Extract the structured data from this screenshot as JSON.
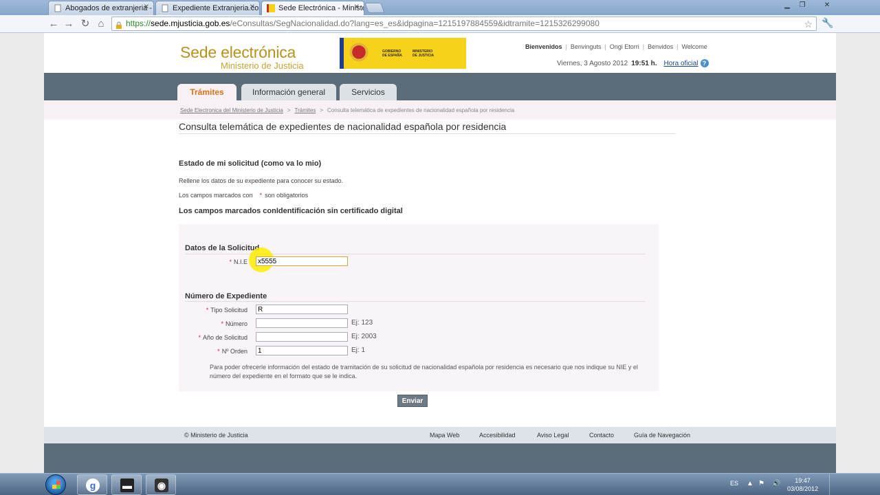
{
  "browser": {
    "tabs": [
      {
        "title": "Abogados de extranjeria - J",
        "active": false
      },
      {
        "title": "Expediente Extranjeria.com",
        "active": false
      },
      {
        "title": "Sede Electrónica - Minister",
        "active": true
      }
    ],
    "url": {
      "scheme": "https://",
      "host": "sede.mjusticia.gob.es",
      "path": "/eConsultas/SegNacionalidad.do?lang=es_es&idpagina=1215197884559&idtramite=1215326299080"
    }
  },
  "header": {
    "title": "Sede electrónica",
    "subtitle": "Ministerio de Justicia",
    "logo_text_1": "GOBIERNO\nDE ESPAÑA",
    "logo_text_2": "MINISTERIO\nDE JUSTICIA",
    "languages": [
      "Bienvenidos",
      "Benvinguts",
      "Ongi Etorri",
      "Benvidos",
      "Welcome"
    ],
    "date": "Viernes, 3 Agosto 2012",
    "time": "19:51 h.",
    "official_time_link": "Hora oficial"
  },
  "nav": {
    "tabs": [
      {
        "label": "Trámites",
        "active": true
      },
      {
        "label": "Información general",
        "active": false
      },
      {
        "label": "Servicios",
        "active": false
      }
    ]
  },
  "breadcrumb": {
    "items": [
      "Sede Electronica del Ministerio de Justicia",
      "Trámites",
      "Consulta telemática de expedientes de nacionalidad española por residencia"
    ],
    "separator": ">"
  },
  "page": {
    "title": "Consulta telemática de expedientes de nacionalidad española por residencia",
    "section_heading": "Estado de mi solicitud (como va lo mio)",
    "intro": "Rellene los datos de su expediente para conocer su estado.",
    "required_prefix": "Los campos marcados con",
    "required_asterisk": "*",
    "required_suffix": "son obligatorios",
    "cert_heading": "Los campos marcados conIdentificación sin certificado digital"
  },
  "form": {
    "solicitud_legend": "Datos de la Solicitud",
    "nie_label": "N.I.E",
    "nie_value": "x5555",
    "expediente_legend": "Número de Expediente",
    "tipo_label": "Tipo Solicitud",
    "tipo_value": "R",
    "numero_label": "Número",
    "numero_value": "",
    "numero_hint": "Ej: 123",
    "anio_label": "Año de Solicitud",
    "anio_value": "",
    "anio_hint": "Ej: 2003",
    "orden_label": "Nº Orden",
    "orden_value": "1",
    "orden_hint": "Ej: 1",
    "info": "Para poder ofrecerle información del estado de tramitación de su solicitud de nacionalidad española por residencia es necesario que nos indique su NIE y el número del expediente en el formato que se le indica.",
    "submit_label": "Enviar"
  },
  "footer": {
    "copyright": "© Ministerio de Justicia",
    "links": [
      "Mapa Web",
      "Accesibilidad",
      "Aviso Legal",
      "Contacto",
      "Guía de Navegación"
    ]
  },
  "taskbar": {
    "language": "ES",
    "clock_time": "19:47",
    "clock_date": "03/08/2012"
  },
  "colors": {
    "brand_gold": "#b8921e",
    "nav_bar": "#5b6b77",
    "active_tab_text": "#d9731a",
    "required_asterisk": "#cc3333"
  }
}
